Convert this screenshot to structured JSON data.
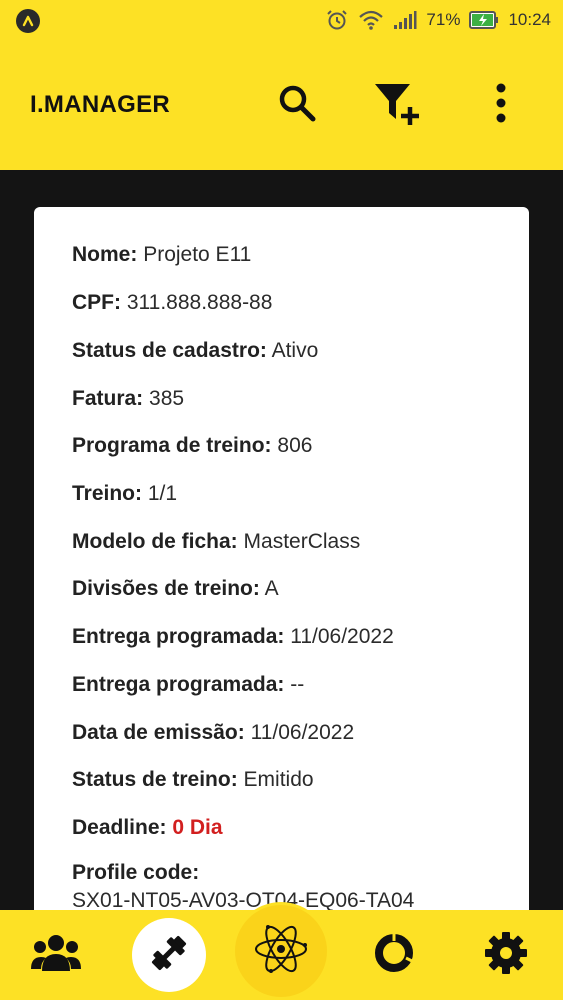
{
  "status_bar": {
    "battery": "71%",
    "time": "10:24",
    "icons": [
      "app-logo-icon",
      "alarm-icon",
      "wifi-icon",
      "signal-icon",
      "battery-charging-icon"
    ]
  },
  "app_bar": {
    "title": "I.MANAGER",
    "actions": [
      "search-icon",
      "filter-add-icon",
      "more-vert-icon"
    ]
  },
  "card": {
    "fields": [
      {
        "label": "Nome:",
        "value": "Projeto E11"
      },
      {
        "label": "CPF:",
        "value": "311.888.888-88"
      },
      {
        "label": "Status de cadastro:",
        "value": "Ativo"
      },
      {
        "label": "Fatura:",
        "value": "385"
      },
      {
        "label": "Programa de treino:",
        "value": "806"
      },
      {
        "label": "Treino:",
        "value": "1/1"
      },
      {
        "label": "Modelo de ficha:",
        "value": "MasterClass"
      },
      {
        "label": "Divisões de treino:",
        "value": "A"
      },
      {
        "label": "Entrega programada:",
        "value": "11/06/2022"
      },
      {
        "label": "Entrega programada:",
        "value": " --"
      },
      {
        "label": "Data de emissão:",
        "value": "11/06/2022"
      },
      {
        "label": "Status de treino:",
        "value": "Emitido"
      },
      {
        "label": "Deadline:",
        "value": "0 Dia"
      },
      {
        "label": "Profile code:",
        "value": "SX01-NT05-AV03-OT04-EQ06-TA04"
      }
    ]
  },
  "bottom_nav": {
    "items": [
      "groups-icon",
      "fitness-icon",
      "atom-icon",
      "donut-chart-icon",
      "settings-icon"
    ]
  },
  "colors": {
    "accent": "#FDE125",
    "background": "#141414",
    "deadline": "#D21F1F"
  }
}
